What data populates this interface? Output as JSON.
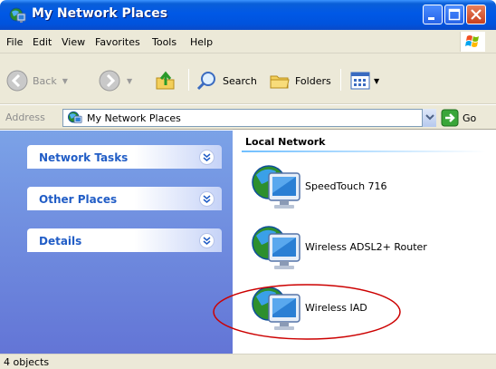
{
  "window": {
    "title": "My Network Places"
  },
  "menu": [
    {
      "label": "File",
      "key": "F"
    },
    {
      "label": "Edit",
      "key": "E"
    },
    {
      "label": "View",
      "key": "V"
    },
    {
      "label": "Favorites",
      "key": "a"
    },
    {
      "label": "Tools",
      "key": "T"
    },
    {
      "label": "Help",
      "key": "H"
    }
  ],
  "toolbar": {
    "back": "Back",
    "search": "Search",
    "folders": "Folders"
  },
  "address": {
    "label": "Address",
    "value": "My Network Places",
    "go": "Go"
  },
  "tasks": [
    {
      "label": "Network Tasks"
    },
    {
      "label": "Other Places"
    },
    {
      "label": "Details"
    }
  ],
  "content": {
    "section": "Local Network",
    "items": [
      {
        "label": "SpeedTouch 716"
      },
      {
        "label": "Wireless ADSL2+ Router"
      },
      {
        "label": "Wireless IAD"
      }
    ]
  },
  "status": {
    "text": "4 objects"
  },
  "colors": {
    "title_bar": "#0058e6",
    "task_pane": "#6f8ee0",
    "task_title": "#215dc6",
    "highlight_ellipse": "#cc0000"
  }
}
